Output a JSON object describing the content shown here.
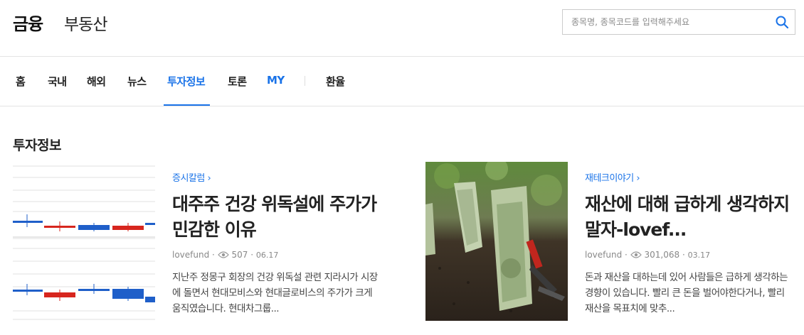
{
  "header": {
    "brand": "금융",
    "brand_sub": "부동산",
    "search_placeholder": "종목명, 종목코드를 입력해주세요"
  },
  "nav": {
    "items": [
      {
        "label": "홈"
      },
      {
        "label": "국내"
      },
      {
        "label": "해외"
      },
      {
        "label": "뉴스"
      },
      {
        "label": "투자정보"
      },
      {
        "label": "토론"
      },
      {
        "label": "MY"
      },
      {
        "label": "환율"
      }
    ],
    "active": "투자정보"
  },
  "section": {
    "title": "투자정보"
  },
  "articles": [
    {
      "category": "증시칼럼",
      "title": "대주주 건강 위독설에 주가가 민감한 이유",
      "author": "lovefund",
      "views": "507",
      "date": "06.17",
      "summary": "지난주 정몽구 회장의 건강 위독설 관련 지라시가 시장에 돌면서 현대모비스와 현대글로비스의 주가가 크게 움직였습니다. 현대차그룹..."
    },
    {
      "category": "재테크이야기",
      "title": "재산에 대해 급하게 생각하지 말자-lovef...",
      "author": "lovefund",
      "views": "301,068",
      "date": "03.17",
      "summary": "돈과 재산을 대하는데 있어 사람들은 급하게 생각하는 경향이 있습니다. 빨리 큰 돈을 벌어야한다거나, 빨리 재산을 목표치에 맞추..."
    }
  ],
  "colors": {
    "accent": "#1a73e8",
    "candle_up": "#d7261e",
    "candle_down": "#1f5fc9"
  }
}
